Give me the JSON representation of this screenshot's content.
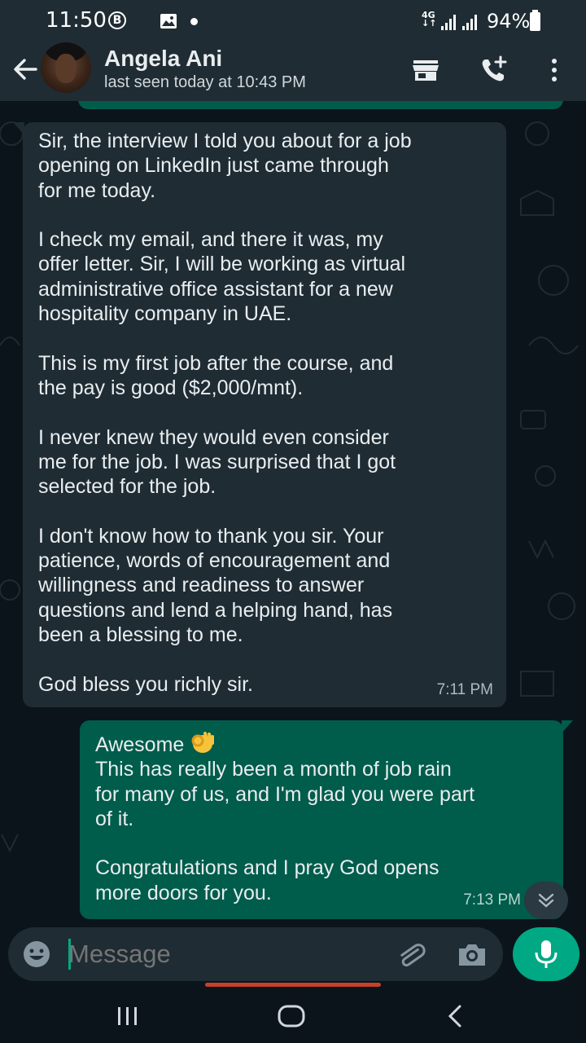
{
  "status_bar": {
    "time": "11:50",
    "b_badge": "B",
    "network": "4G",
    "battery": "94%"
  },
  "header": {
    "contact_name": "Angela Ani",
    "last_seen": "last seen today at 10:43 PM"
  },
  "messages": [
    {
      "direction": "incoming",
      "paragraphs": [
        "Sir, the interview I told you about for a job\nopening on LinkedIn just came through\nfor me today.",
        "I check my email, and there it was, my\noffer letter. Sir, I will be working as virtual\nadministrative office assistant for a new\nhospitality company in UAE.",
        "This is my first job after the course, and\nthe pay is good ($2,000/mnt).",
        "I never knew they would even consider\nme for the job. I was surprised that I got\nselected for the job.",
        "I don't know how to thank you sir. Your\npatience, words of encouragement and\nwillingness and readiness to answer\nquestions and lend a helping hand, has\nbeen a blessing to me.",
        "God bless you richly sir."
      ],
      "time": "7:11 PM"
    },
    {
      "direction": "outgoing",
      "first_line": "Awesome",
      "first_line_emoji": "ok-hand-emoji",
      "paragraphs": [
        "This has really been a month of job rain\nfor many of us, and I'm glad you were part\nof it.",
        "Congratulations and I pray God opens\nmore doors for you."
      ],
      "time": "7:13 PM"
    }
  ],
  "composer": {
    "placeholder": "Message"
  },
  "colors": {
    "incoming_bubble": "#1f2c34",
    "outgoing_bubble": "#005c4b",
    "accent": "#00a884",
    "background": "#0b141a"
  }
}
